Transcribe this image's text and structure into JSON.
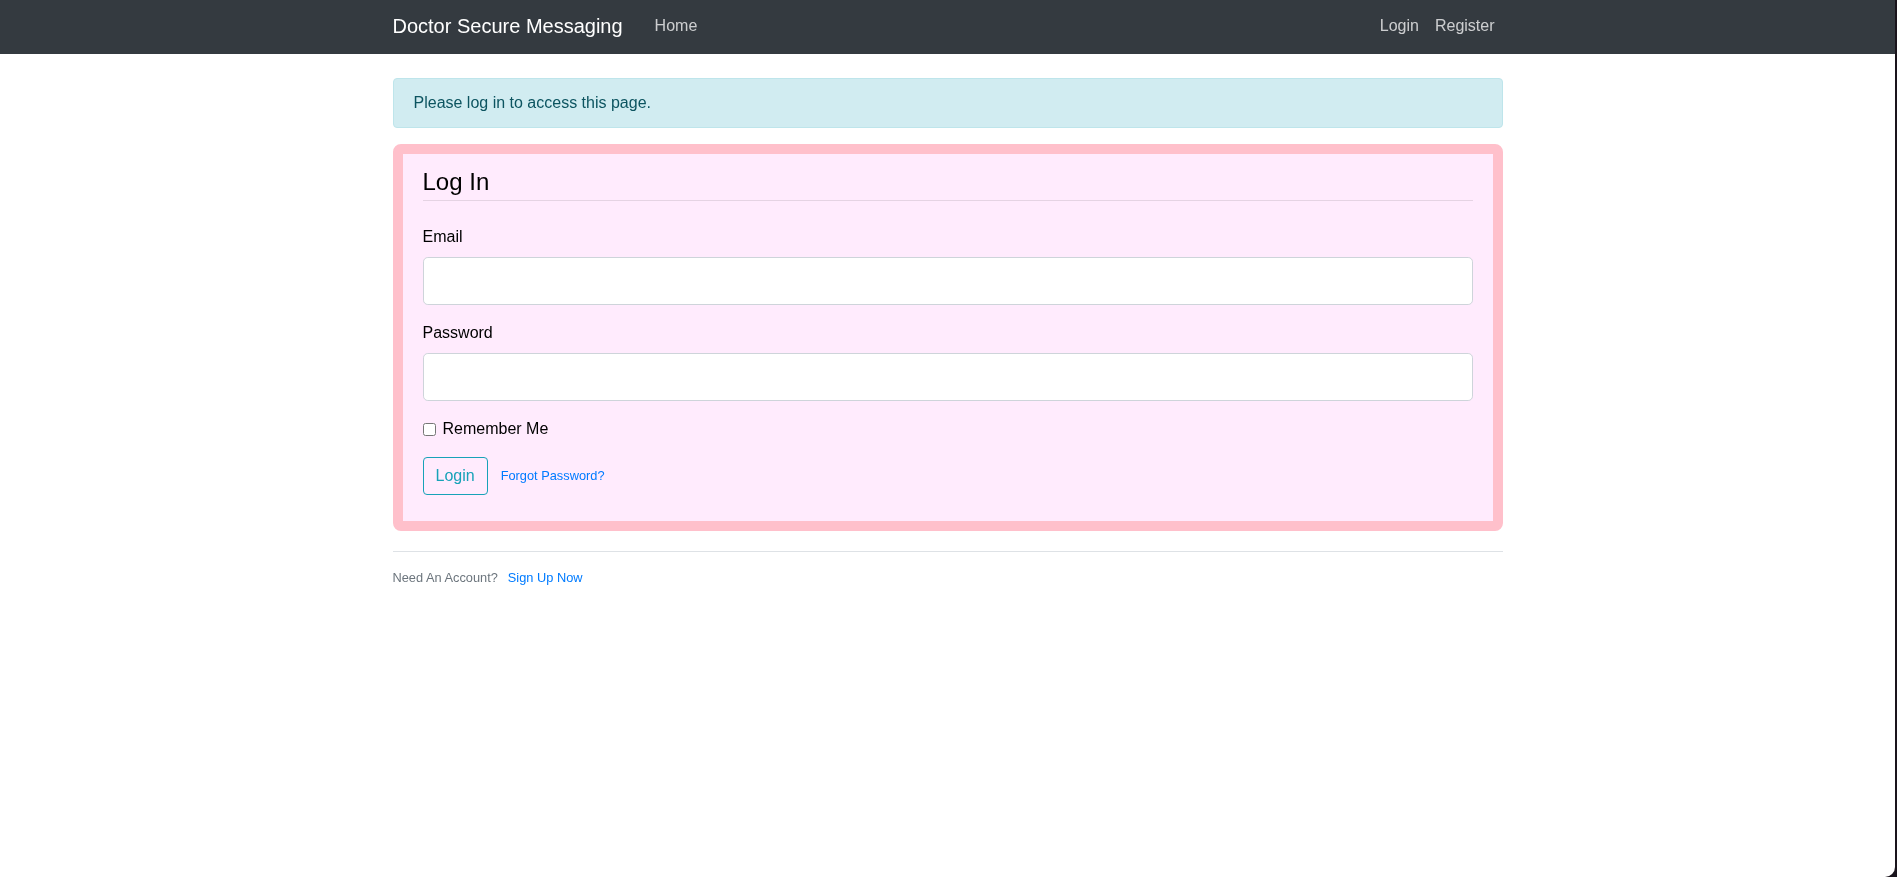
{
  "navbar": {
    "brand": "Doctor Secure Messaging",
    "links": [
      {
        "label": "Home"
      }
    ],
    "right_links": [
      {
        "label": "Login"
      },
      {
        "label": "Register"
      }
    ]
  },
  "alert": {
    "kind": "info",
    "text": "Please log in to access this page."
  },
  "login_form": {
    "title": "Log In",
    "fields": [
      {
        "label": "Email"
      },
      {
        "label": "Password"
      }
    ],
    "remember": {
      "label": "Remember Me",
      "checked": false
    },
    "submit": "Login",
    "forgot_link": "Forgot Password?"
  },
  "footer": {
    "text": "Need An Account?",
    "link": "Sign Up Now"
  }
}
